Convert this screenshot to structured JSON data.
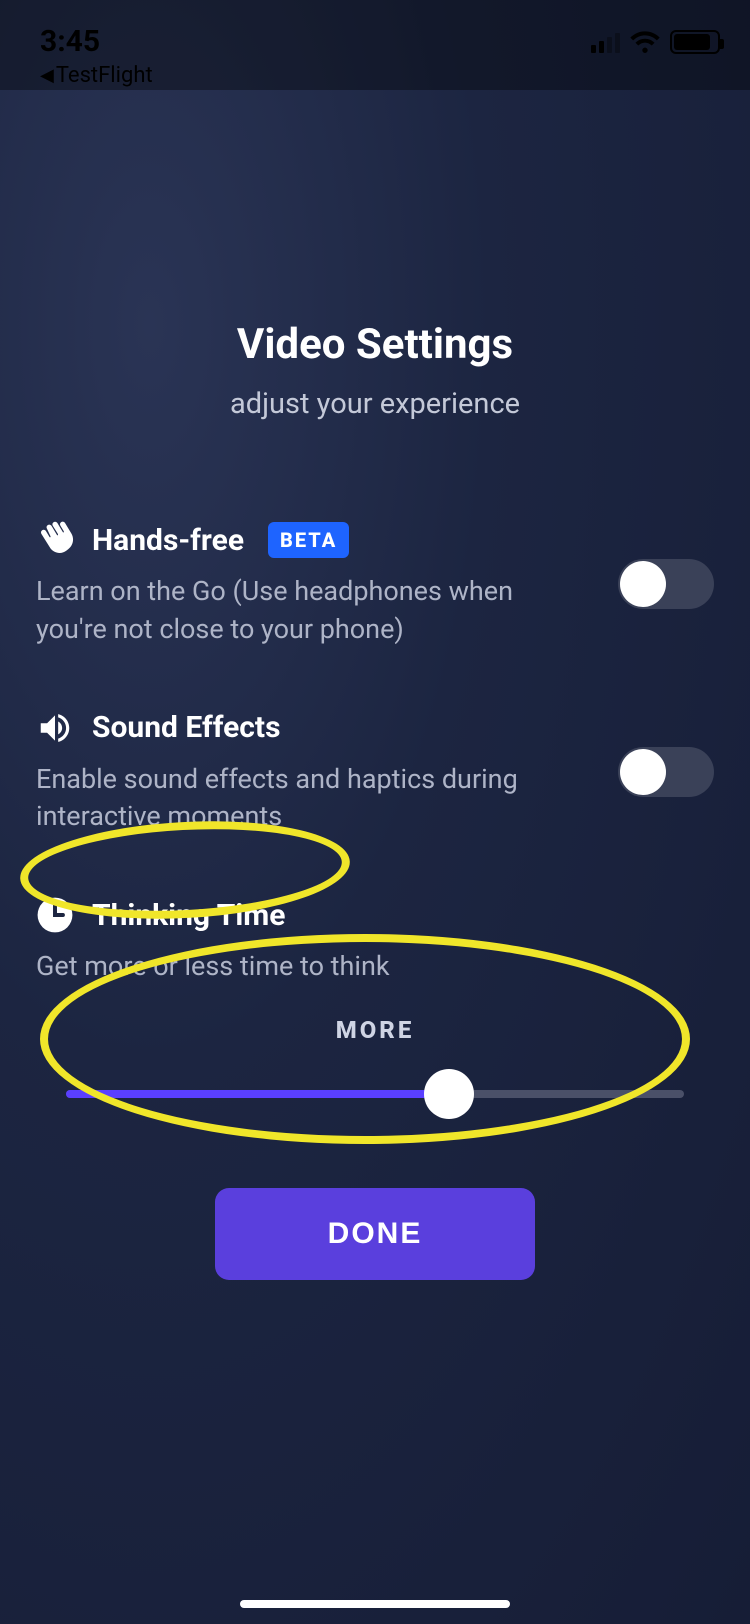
{
  "status": {
    "time": "3:45",
    "back_label": "TestFlight"
  },
  "header": {
    "title": "Video Settings",
    "subtitle": "adjust your experience"
  },
  "settings": {
    "handsfree": {
      "title": "Hands-free",
      "badge": "BETA",
      "desc": "Learn on the Go (Use headphones when you're not close to your phone)"
    },
    "sound": {
      "title": "Sound Effects",
      "desc": "Enable sound effects and haptics during interactive moments"
    },
    "thinking": {
      "title": "Thinking Time",
      "desc": "Get more or less time to think",
      "slider_label": "MORE"
    }
  },
  "actions": {
    "done": "DONE"
  }
}
